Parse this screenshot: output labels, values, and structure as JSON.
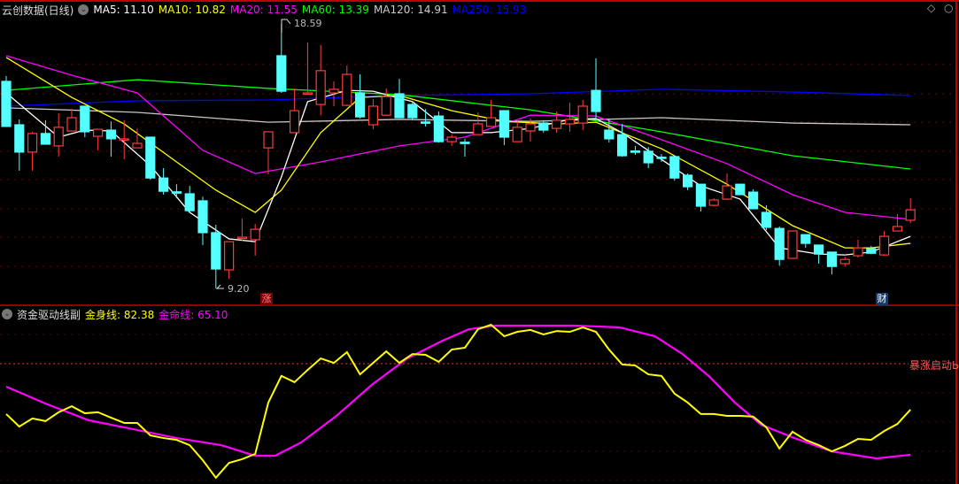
{
  "header": {
    "title": "云创数据(日线)",
    "ma": [
      {
        "label": "MA5: 11.10",
        "color": "#ffffff"
      },
      {
        "label": "MA10: 10.82",
        "color": "#ffff00"
      },
      {
        "label": "MA20: 11.55",
        "color": "#ff00ff"
      },
      {
        "label": "MA60: 13.39",
        "color": "#00ff00"
      },
      {
        "label": "MA120: 14.91",
        "color": "#cccccc"
      },
      {
        "label": "MA250: 15.93",
        "color": "#0000ff"
      }
    ]
  },
  "markers": {
    "high": "18.59",
    "low": "9.20",
    "badge_up": "涨",
    "badge_fin": "财"
  },
  "indicator": {
    "title": "资金驱动线副",
    "line1_label": "金身线: 82.38",
    "line2_label": "金命线: 65.10",
    "signal_label": "暴涨启动Ы"
  },
  "colors": {
    "up": "#ff3b3b",
    "down": "#54ffff",
    "grid": "#7a0000",
    "border": "#c00000"
  },
  "chart_data": {
    "type": "candlestick",
    "price_range": [
      9.2,
      18.59
    ],
    "ohlc": [
      [
        16.55,
        16.74,
        14.95,
        14.95
      ],
      [
        15.01,
        15.2,
        13.38,
        14.04
      ],
      [
        14.04,
        14.76,
        13.38,
        14.7
      ],
      [
        14.7,
        15.17,
        14.32,
        14.32
      ],
      [
        14.26,
        15.42,
        13.88,
        14.92
      ],
      [
        14.79,
        15.57,
        14.79,
        15.26
      ],
      [
        15.67,
        15.67,
        14.57,
        14.76
      ],
      [
        14.6,
        14.85,
        14.1,
        14.85
      ],
      [
        14.82,
        15.13,
        13.88,
        14.51
      ],
      [
        14.49,
        15.17,
        13.78,
        14.51
      ],
      [
        14.19,
        14.88,
        14.19,
        14.35
      ],
      [
        14.57,
        14.57,
        13.06,
        13.12
      ],
      [
        13.12,
        13.47,
        12.53,
        12.65
      ],
      [
        12.63,
        12.9,
        12.4,
        12.62
      ],
      [
        12.56,
        12.84,
        11.9,
        11.96
      ],
      [
        12.31,
        12.46,
        10.74,
        11.18
      ],
      [
        11.18,
        11.46,
        9.2,
        9.89
      ],
      [
        9.86,
        10.86,
        9.54,
        10.86
      ],
      [
        10.99,
        11.68,
        10.89,
        11.02
      ],
      [
        10.93,
        11.49,
        10.36,
        11.3
      ],
      [
        14.19,
        14.76,
        13.25,
        14.76
      ],
      [
        17.46,
        18.59,
        16.14,
        16.2
      ],
      [
        14.73,
        16.3,
        14.73,
        15.51
      ],
      [
        16.14,
        17.93,
        16.08,
        16.14
      ],
      [
        15.73,
        17.84,
        15.35,
        16.93
      ],
      [
        16.14,
        16.55,
        15.67,
        16.27
      ],
      [
        15.7,
        17.11,
        15.67,
        16.8
      ],
      [
        16.14,
        16.8,
        15.23,
        15.29
      ],
      [
        15.01,
        15.92,
        14.85,
        15.67
      ],
      [
        15.35,
        16.3,
        15.32,
        16.01
      ],
      [
        16.11,
        16.64,
        15.26,
        15.26
      ],
      [
        15.73,
        15.83,
        15.17,
        15.26
      ],
      [
        15.11,
        15.57,
        14.95,
        15.1
      ],
      [
        15.32,
        15.48,
        14.38,
        14.41
      ],
      [
        14.41,
        14.66,
        14.26,
        14.57
      ],
      [
        14.39,
        14.51,
        13.88,
        14.38
      ],
      [
        14.66,
        15.45,
        14.66,
        15.04
      ],
      [
        14.95,
        15.89,
        14.95,
        15.26
      ],
      [
        15.51,
        15.51,
        14.29,
        14.57
      ],
      [
        14.41,
        15.13,
        14.41,
        14.92
      ],
      [
        14.79,
        15.23,
        14.41,
        15.04
      ],
      [
        15.07,
        15.17,
        14.73,
        14.82
      ],
      [
        14.88,
        15.48,
        14.73,
        15.17
      ],
      [
        15.04,
        15.79,
        14.76,
        15.2
      ],
      [
        15.07,
        15.89,
        14.82,
        15.67
      ],
      [
        16.23,
        17.37,
        15.2,
        15.48
      ],
      [
        14.82,
        15.2,
        14.38,
        14.51
      ],
      [
        14.66,
        15.04,
        13.88,
        13.91
      ],
      [
        14.08,
        14.26,
        13.94,
        14.07
      ],
      [
        14.07,
        14.22,
        13.47,
        13.66
      ],
      [
        13.86,
        13.97,
        13.69,
        13.85
      ],
      [
        13.88,
        13.88,
        13.03,
        13.12
      ],
      [
        13.22,
        13.28,
        12.69,
        12.81
      ],
      [
        12.9,
        12.9,
        11.93,
        12.12
      ],
      [
        12.15,
        12.4,
        12.12,
        12.34
      ],
      [
        12.37,
        13.28,
        12.34,
        12.84
      ],
      [
        12.9,
        12.9,
        12.53,
        12.53
      ],
      [
        12.62,
        12.72,
        12.03,
        12.03
      ],
      [
        11.9,
        12.15,
        11.27,
        11.37
      ],
      [
        11.33,
        11.4,
        10.01,
        10.23
      ],
      [
        10.27,
        11.24,
        10.27,
        11.24
      ],
      [
        11.11,
        11.11,
        10.64,
        10.8
      ],
      [
        10.74,
        10.74,
        10.08,
        10.42
      ],
      [
        10.49,
        10.49,
        9.7,
        9.98
      ],
      [
        10.08,
        10.33,
        9.98,
        10.23
      ],
      [
        10.36,
        10.93,
        10.3,
        10.64
      ],
      [
        10.61,
        10.71,
        10.42,
        10.45
      ],
      [
        10.39,
        11.24,
        10.36,
        11.05
      ],
      [
        11.24,
        11.84,
        11.24,
        11.4
      ],
      [
        11.62,
        12.4,
        11.52,
        11.99
      ]
    ],
    "ma_series": [
      {
        "name": "MA250",
        "color": "#0000ff",
        "points": [
          [
            0,
            15.67
          ],
          [
            10,
            15.86
          ],
          [
            20,
            15.89
          ],
          [
            30,
            16.05
          ],
          [
            40,
            16.11
          ],
          [
            50,
            16.27
          ],
          [
            60,
            16.17
          ],
          [
            69,
            16.05
          ]
        ]
      },
      {
        "name": "MA120",
        "color": "#c8c8c8",
        "points": [
          [
            0,
            15.61
          ],
          [
            10,
            15.45
          ],
          [
            20,
            15.1
          ],
          [
            30,
            15.2
          ],
          [
            40,
            15.13
          ],
          [
            50,
            15.26
          ],
          [
            60,
            15.07
          ],
          [
            69,
            15.01
          ]
        ]
      },
      {
        "name": "MA60",
        "color": "#00ff00",
        "points": [
          [
            0,
            16.23
          ],
          [
            10,
            16.61
          ],
          [
            20,
            16.3
          ],
          [
            30,
            16.08
          ],
          [
            40,
            15.54
          ],
          [
            50,
            14.76
          ],
          [
            60,
            13.91
          ],
          [
            69,
            13.44
          ]
        ]
      },
      {
        "name": "MA20",
        "color": "#ff00ff",
        "points": [
          [
            0,
            17.46
          ],
          [
            5,
            16.77
          ],
          [
            10,
            16.14
          ],
          [
            15,
            14.1
          ],
          [
            19,
            13.28
          ],
          [
            24,
            13.69
          ],
          [
            30,
            14.26
          ],
          [
            35,
            14.57
          ],
          [
            40,
            15.35
          ],
          [
            45,
            15.32
          ],
          [
            50,
            14.48
          ],
          [
            55,
            13.63
          ],
          [
            60,
            12.53
          ],
          [
            64,
            11.9
          ],
          [
            69,
            11.65
          ]
        ]
      },
      {
        "name": "MA10",
        "color": "#ffff00",
        "points": [
          [
            0,
            17.4
          ],
          [
            5,
            15.98
          ],
          [
            9,
            15.04
          ],
          [
            13,
            13.69
          ],
          [
            16,
            12.69
          ],
          [
            19,
            11.9
          ],
          [
            21,
            12.69
          ],
          [
            24,
            14.73
          ],
          [
            27,
            15.98
          ],
          [
            30,
            16.05
          ],
          [
            34,
            15.51
          ],
          [
            38,
            15.13
          ],
          [
            42,
            15.04
          ],
          [
            45,
            15.1
          ],
          [
            50,
            14.16
          ],
          [
            55,
            12.9
          ],
          [
            60,
            11.43
          ],
          [
            64,
            10.64
          ],
          [
            66,
            10.64
          ],
          [
            69,
            10.8
          ]
        ]
      },
      {
        "name": "MA5",
        "color": "#ffffff",
        "points": [
          [
            0,
            16.14
          ],
          [
            4,
            14.57
          ],
          [
            6,
            14.82
          ],
          [
            8,
            14.79
          ],
          [
            11,
            13.56
          ],
          [
            14,
            11.9
          ],
          [
            17,
            10.96
          ],
          [
            19,
            10.86
          ],
          [
            21,
            13.16
          ],
          [
            23,
            15.83
          ],
          [
            26,
            16.23
          ],
          [
            28,
            16.2
          ],
          [
            31,
            15.83
          ],
          [
            34,
            14.73
          ],
          [
            37,
            14.73
          ],
          [
            40,
            14.88
          ],
          [
            43,
            15.2
          ],
          [
            45,
            15.23
          ],
          [
            47,
            14.73
          ],
          [
            50,
            13.78
          ],
          [
            53,
            12.84
          ],
          [
            56,
            12.37
          ],
          [
            59,
            10.64
          ],
          [
            62,
            10.42
          ],
          [
            64,
            10.39
          ],
          [
            66,
            10.49
          ],
          [
            69,
            11.05
          ]
        ]
      }
    ],
    "indicator_series": [
      {
        "name": "金身线",
        "color": "#ffff00",
        "values": [
          80.7,
          75.9,
          79.0,
          78.0,
          81.4,
          83.7,
          81.0,
          81.4,
          79.3,
          77.3,
          77.3,
          72.5,
          71.5,
          70.8,
          68.8,
          63.0,
          56.3,
          62.0,
          63.4,
          65.4,
          85.1,
          95.3,
          92.9,
          97.6,
          102.0,
          100.3,
          104.4,
          95.9,
          100.3,
          104.7,
          100.3,
          103.7,
          103.4,
          100.7,
          105.4,
          106.1,
          113.2,
          114.9,
          110.5,
          112.2,
          112.9,
          111.2,
          112.5,
          112.2,
          113.9,
          112.2,
          105.4,
          99.7,
          99.3,
          95.9,
          95.3,
          88.5,
          85.1,
          80.7,
          80.7,
          80.0,
          80.0,
          79.7,
          75.6,
          67.5,
          73.9,
          70.8,
          68.8,
          66.4,
          68.5,
          71.2,
          70.8,
          74.2,
          76.9,
          82.4
        ]
      },
      {
        "name": "金命线",
        "color": "#ff00ff",
        "points": [
          [
            0,
            91.2
          ],
          [
            3,
            84.7
          ],
          [
            6.3,
            78.3
          ],
          [
            9.7,
            74.9
          ],
          [
            13,
            71.5
          ],
          [
            16.4,
            68.8
          ],
          [
            19,
            64.7
          ],
          [
            20.5,
            64.7
          ],
          [
            22.5,
            69.8
          ],
          [
            25.2,
            80.0
          ],
          [
            27.9,
            91.9
          ],
          [
            30.6,
            102.0
          ],
          [
            33.3,
            108.8
          ],
          [
            35.3,
            113.2
          ],
          [
            37.4,
            114.6
          ],
          [
            40.1,
            114.6
          ],
          [
            43.4,
            114.6
          ],
          [
            46.8,
            113.9
          ],
          [
            49.5,
            110.5
          ],
          [
            51.6,
            103.7
          ],
          [
            53.6,
            95.3
          ],
          [
            55.6,
            85.1
          ],
          [
            57.6,
            76.6
          ],
          [
            60.3,
            71.2
          ],
          [
            63,
            66.4
          ],
          [
            66.4,
            63.7
          ],
          [
            69,
            65.1
          ]
        ]
      }
    ],
    "signal_level": 100
  }
}
